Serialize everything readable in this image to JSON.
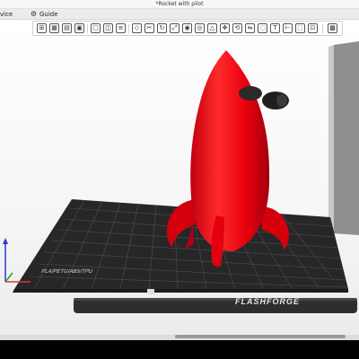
{
  "window": {
    "title": "*Rocket with pilot"
  },
  "menubar": {
    "items": [
      "vice",
      "Guide"
    ]
  },
  "toolbar": {
    "tools": [
      "add-icon",
      "grid-icon",
      "table-icon",
      "frame-icon",
      "arrange-icon",
      "split-icon",
      "layers-icon",
      "orient-icon",
      "cut-icon",
      "rotate-icon",
      "scale-icon",
      "support-icon",
      "seam-icon",
      "variable-layer-icon",
      "move-icon",
      "rotate3d-icon",
      "mirror-icon",
      "brim-icon",
      "text-icon",
      "measure-icon",
      "assembly-icon",
      "view-icon"
    ]
  },
  "bed": {
    "brand": "FLASHFORGE",
    "filament_label": "PLA/PETG/ABS/TPU",
    "bed_color": "#2b2b2b",
    "grid_color": "#5a5a5a"
  },
  "model": {
    "name": "Rocket with pilot",
    "color": "#e8000e"
  },
  "colors": {
    "accent": "#e8000e",
    "axis_x": "#e33333",
    "axis_y": "#2e9e2e",
    "axis_z": "#2f37c8"
  }
}
